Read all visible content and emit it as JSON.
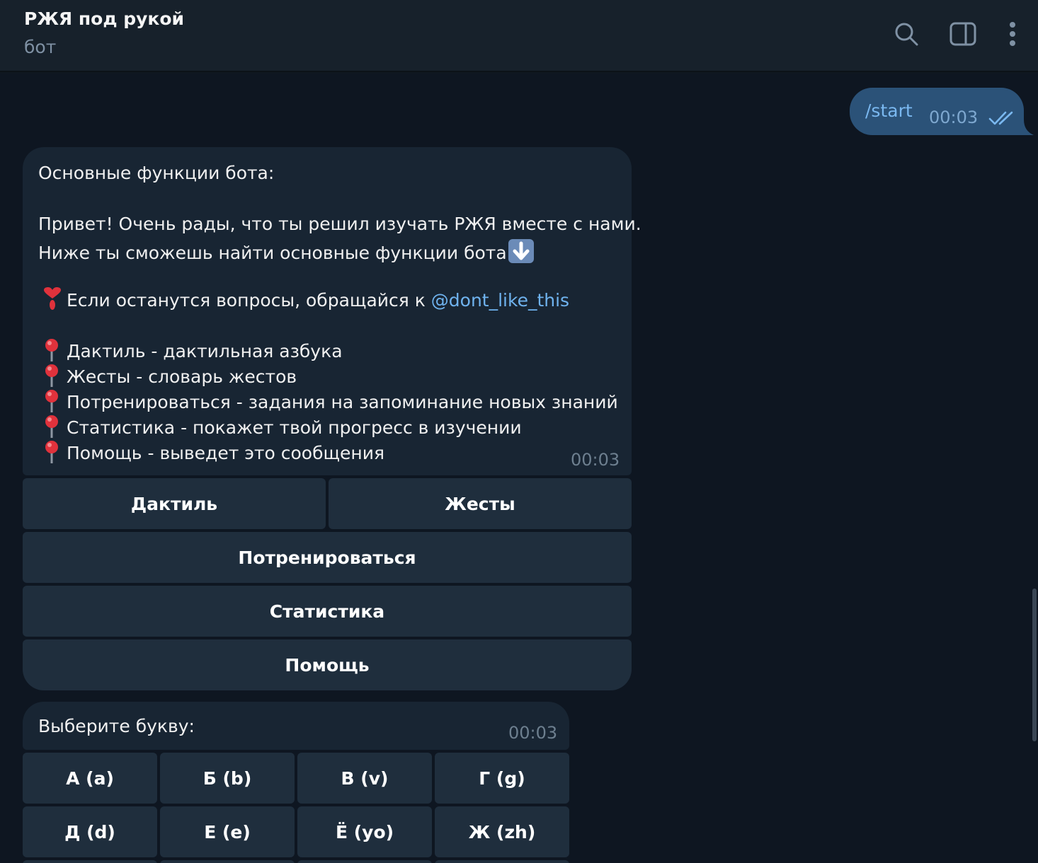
{
  "header": {
    "title": "РЖЯ под рукой",
    "subtitle": "бот"
  },
  "outgoing": {
    "text": "/start",
    "time": "00:03",
    "status": "read"
  },
  "message1": {
    "line_heading": "Основные функции бота:",
    "line_greeting1": "Привет! Очень рады, что ты решил изучать РЖЯ вместе с нами.",
    "line_greeting2": "Ниже ты сможешь найти основные функции бота",
    "line_contact": "Если останутся вопросы, обращайся к ",
    "contact_link": "@dont_like_this",
    "features": [
      "Дактиль - дактильная азбука",
      "Жесты -  словарь жестов",
      "Потренироваться - задания на запоминание новых знаний",
      "Статистика - покажет твой прогресс в изучении",
      "Помощь - выведет это сообщения"
    ],
    "time": "00:03"
  },
  "keyboard1": {
    "dactyl": "Дактиль",
    "gestures": "Жесты",
    "practice": "Потренироваться",
    "stats": "Статистика",
    "help": "Помощь"
  },
  "message2": {
    "text": "Выберите букву:",
    "time": "00:03"
  },
  "keyboard2": {
    "letters": [
      "А (a)",
      "Б (b)",
      "В (v)",
      "Г (g)",
      "Д (d)",
      "Е (e)",
      "Ё (yo)",
      "Ж (zh)"
    ]
  },
  "icons": {
    "search": "search-icon",
    "sidebar": "sidebar-toggle-icon",
    "menu": "more-vertical-icon",
    "pin": "round-pushpin-icon",
    "heart": "heart-exclamation-icon",
    "arrow": "down-arrow-icon",
    "check": "double-check-icon"
  },
  "colors": {
    "accent": "#6fb3ef",
    "bubble_out": "#2b5278",
    "bubble_in": "#182533",
    "button": "#1f2e3d",
    "background": "#0e1621"
  }
}
